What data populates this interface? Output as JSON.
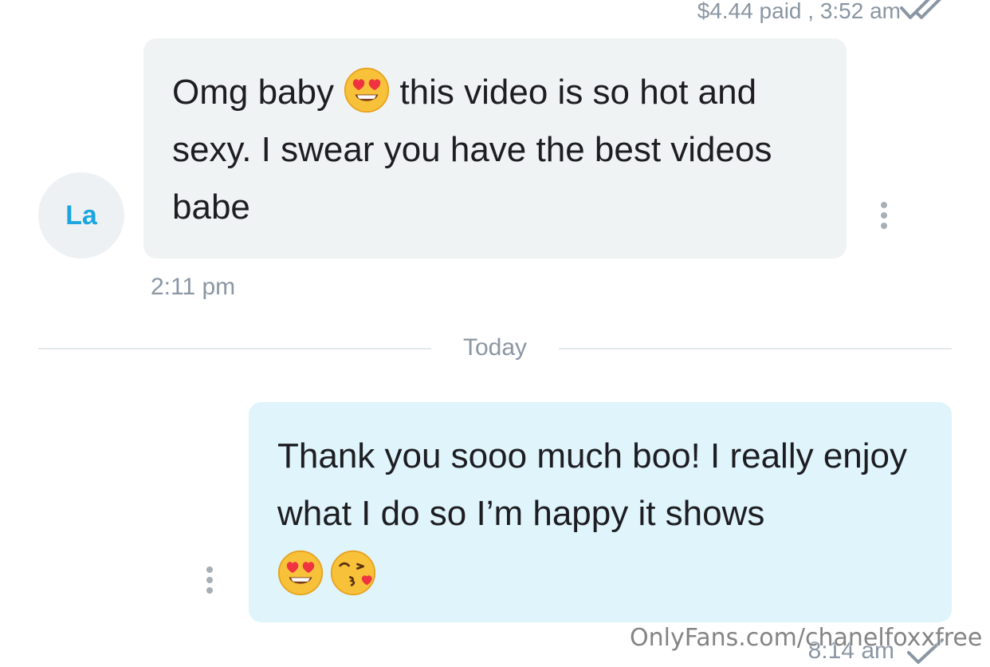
{
  "chat": {
    "top_meta": "$4.44 paid , 3:52 am",
    "incoming": {
      "avatar_initials": "La",
      "text_part1": "Omg baby ",
      "emoji": "heart-eyes-emoji",
      "text_part2": " this video is so hot and sexy. I swear you have the best videos babe",
      "time": "2:11 pm"
    },
    "divider_label": "Today",
    "outgoing": {
      "text": "Thank you sooo much boo! I really enjoy what I do so I’m happy it shows",
      "emojis": [
        "heart-eyes-emoji",
        "kissing-heart-emoji"
      ],
      "time": "8:14 am"
    }
  },
  "watermark": "OnlyFans.com/chanelfoxxfree",
  "colors": {
    "incoming_bubble": "#f0f3f4",
    "outgoing_bubble": "#dff4fb",
    "meta_text": "#8a96a3",
    "avatar_initials": "#1ba6e0",
    "check_marks": "#8a96a3"
  }
}
